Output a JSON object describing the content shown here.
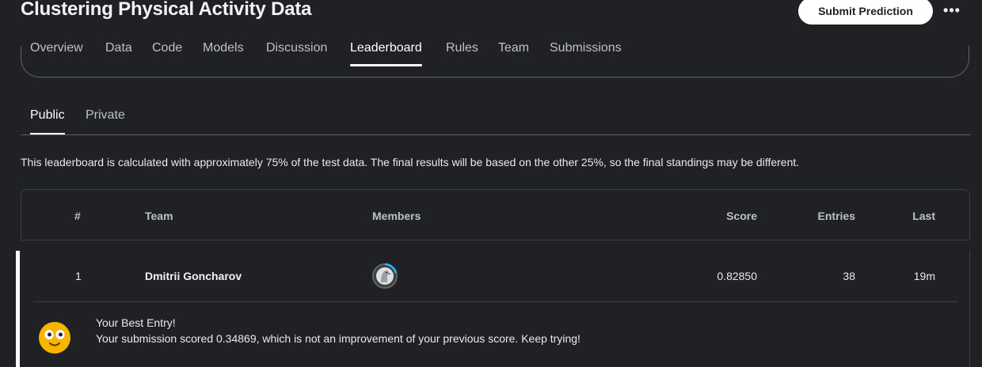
{
  "header": {
    "title": "Clustering Physical Activity Data",
    "submit_label": "Submit Prediction",
    "more_label": "•••"
  },
  "nav": {
    "tabs": [
      {
        "label": "Overview"
      },
      {
        "label": "Data"
      },
      {
        "label": "Code"
      },
      {
        "label": "Models"
      },
      {
        "label": "Discussion"
      },
      {
        "label": "Leaderboard",
        "active": true
      },
      {
        "label": "Rules"
      },
      {
        "label": "Team"
      },
      {
        "label": "Submissions"
      }
    ]
  },
  "leaderboard": {
    "subtabs": [
      {
        "label": "Public",
        "active": true
      },
      {
        "label": "Private"
      }
    ],
    "info": "This leaderboard is calculated with approximately 75% of the test data. The final results will be based on the other 25%, so the final standings may be different.",
    "columns": {
      "rank": "#",
      "team": "Team",
      "members": "Members",
      "score": "Score",
      "entries": "Entries",
      "last": "Last"
    },
    "rows": [
      {
        "rank": "1",
        "team": "Dmitrii Goncharov",
        "member_icon": "avatar-icon",
        "score": "0.82850",
        "entries": "38",
        "last": "19m"
      }
    ],
    "message": {
      "icon": "smiley-emoji-icon",
      "title": "Your Best Entry!",
      "body": "Your submission scored 0.34869, which is not an improvement of your previous score. Keep trying!"
    }
  },
  "colors": {
    "background": "#202124",
    "text": "#e8eaed",
    "muted": "#bdc1c6",
    "border": "#3c4043",
    "accent_white": "#ffffff",
    "avatar_ring": "#20beff",
    "emoji_yellow": "#f7b500"
  }
}
